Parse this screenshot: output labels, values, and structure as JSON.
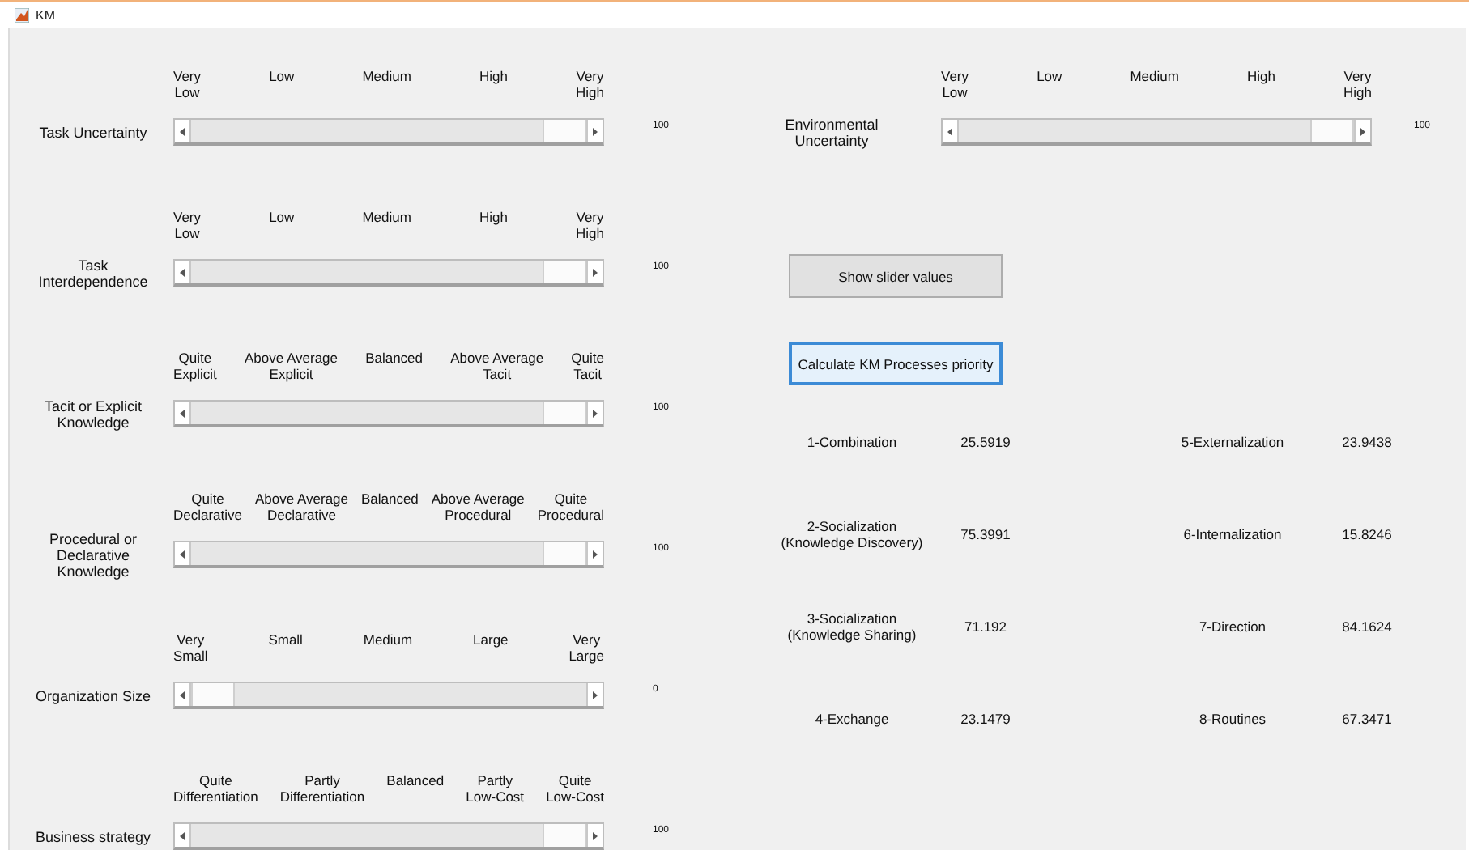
{
  "window": {
    "title": "KM"
  },
  "left_sliders": [
    {
      "label": "Task Uncertainty",
      "ticks": [
        "Very\nLow",
        "Low",
        "Medium",
        "High",
        "Very\nHigh"
      ],
      "level": 1,
      "reading": "100"
    },
    {
      "label": "Task\nInterdependence",
      "ticks": [
        "Very\nLow",
        "Low",
        "Medium",
        "High",
        "Very\nHigh"
      ],
      "level": 1,
      "reading": "100"
    },
    {
      "label": "Tacit or Explicit\nKnowledge",
      "ticks": [
        "Quite\nExplicit",
        "Above Average\nExplicit",
        "Balanced",
        "Above Average\nTacit",
        "Quite\nTacit"
      ],
      "level": 1,
      "reading": "100"
    },
    {
      "label": "Procedural or\nDeclarative\nKnowledge",
      "ticks": [
        "Quite\nDeclarative",
        "Above Average\nDeclarative",
        "Balanced",
        "Above Average\nProcedural",
        "Quite\nProcedural"
      ],
      "level": 1,
      "reading": "100"
    },
    {
      "label": "Organization Size",
      "ticks": [
        "Very\nSmall",
        "Small",
        "Medium",
        "Large",
        "Very\nLarge"
      ],
      "level": 0,
      "reading": "0"
    },
    {
      "label": "Business strategy",
      "ticks": [
        "Quite\nDifferentiation",
        "Partly\nDifferentiation",
        "Balanced",
        "Partly\nLow-Cost",
        "Quite\nLow-Cost"
      ],
      "level": 1,
      "reading": "100"
    }
  ],
  "right_sliders": [
    {
      "label": "Environmental\nUncertainty",
      "ticks": [
        "Very\nLow",
        "Low",
        "Medium",
        "High",
        "Very\nHigh"
      ],
      "level": 1,
      "reading": "100"
    }
  ],
  "buttons": [
    {
      "label": "Show slider values",
      "focused": false
    },
    {
      "label": "Calculate KM Processes priority",
      "focused": true
    }
  ],
  "results": [
    {
      "name": "1-Combination",
      "value": "25.5919"
    },
    {
      "name": "5-Externalization",
      "value": "23.9438"
    },
    {
      "name": "2-Socialization\n(Knowledge Discovery)",
      "value": "75.3991"
    },
    {
      "name": "6-Internalization",
      "value": "15.8246"
    },
    {
      "name": "3-Socialization\n(Knowledge Sharing)",
      "value": "71.192"
    },
    {
      "name": "7-Direction",
      "value": "84.1624"
    },
    {
      "name": "4-Exchange",
      "value": "23.1479"
    },
    {
      "name": "8-Routines",
      "value": "67.3471"
    }
  ]
}
